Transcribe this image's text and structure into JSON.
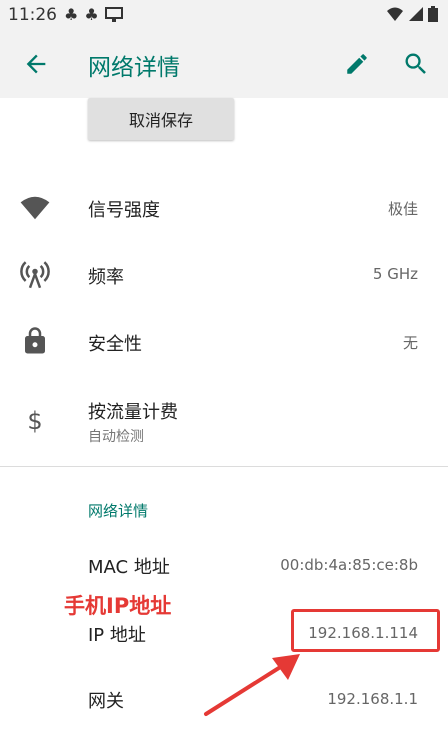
{
  "status_bar": {
    "time": "11:26"
  },
  "app_bar": {
    "title": "网络详情",
    "back_icon": "arrow-back-icon",
    "edit_icon": "pencil-icon",
    "search_icon": "search-icon"
  },
  "forget_button": "取消保存",
  "details": [
    {
      "label": "信号强度",
      "value": "极佳",
      "icon": "wifi-icon"
    },
    {
      "label": "频率",
      "value": "5 GHz",
      "icon": "antenna-icon"
    },
    {
      "label": "安全性",
      "value": "无",
      "icon": "lock-icon"
    },
    {
      "label": "按流量计费",
      "sub": "自动检测",
      "icon": "dollar-icon"
    }
  ],
  "network_section": {
    "title": "网络详情",
    "rows": [
      {
        "label": "MAC 地址",
        "value": "00:db:4a:85:ce:8b"
      },
      {
        "label": "IP 地址",
        "value": "192.168.1.114"
      },
      {
        "label": "网关",
        "value": "192.168.1.1"
      }
    ]
  },
  "annotation": {
    "text": "手机IP地址",
    "color": "#e53935"
  },
  "colors": {
    "accent": "#00796b",
    "annotation_red": "#e53935"
  }
}
